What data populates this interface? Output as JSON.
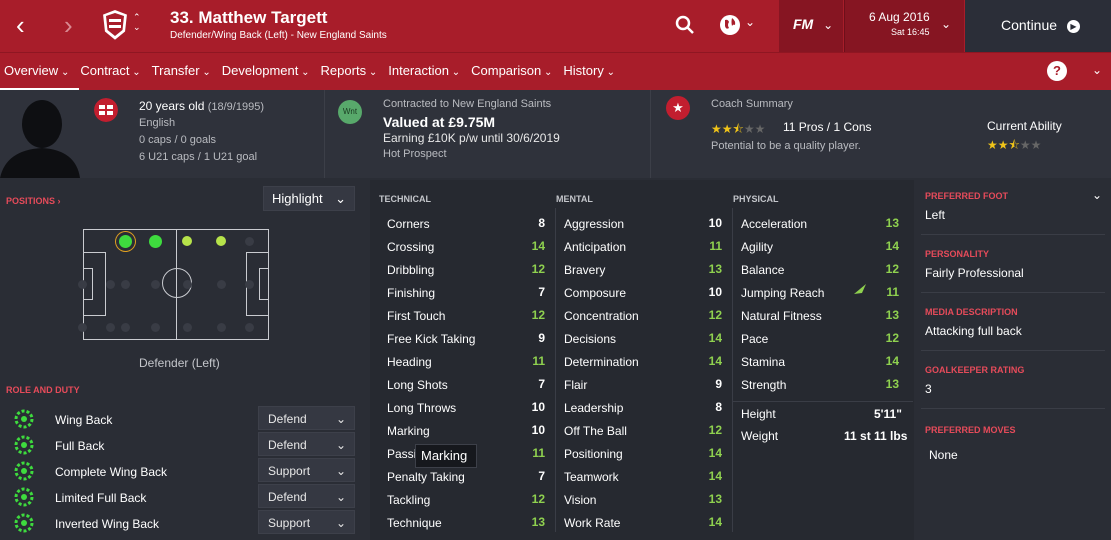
{
  "header": {
    "player_title": "33. Matthew Targett",
    "player_sub": "Defender/Wing Back (Left) - New England Saints",
    "fm_label": "FM",
    "date": "6 Aug 2016",
    "time": "Sat 16:45",
    "continue_label": "Continue"
  },
  "tabs": [
    "Overview",
    "Contract",
    "Transfer",
    "Development",
    "Reports",
    "Interaction",
    "Comparison",
    "History"
  ],
  "info": {
    "age": "20 years old",
    "dob": "(18/9/1995)",
    "nationality": "English",
    "caps": "0 caps / 0 goals",
    "u21": "6 U21 caps / 1 U21 goal",
    "contract_line": "Contracted to New England Saints",
    "value": "Valued at £9.75M",
    "earning": "Earning £10K p/w until 30/6/2019",
    "status": "Hot Prospect",
    "wnt_badge": "Wnt",
    "coach_title": "Coach Summary",
    "pros_cons": "11 Pros / 1 Cons",
    "potential_note": "Potential to be a quality player.",
    "current_ability_label": "Current Ability",
    "potential_stars": 2.5,
    "current_stars": 2.5
  },
  "positions": {
    "label": "POSITIONS",
    "highlight": "Highlight",
    "position_name": "Defender (Left)"
  },
  "role_title": "ROLE AND DUTY",
  "roles": [
    {
      "name": "Wing Back",
      "duty": "Defend"
    },
    {
      "name": "Full Back",
      "duty": "Defend"
    },
    {
      "name": "Complete Wing Back",
      "duty": "Support"
    },
    {
      "name": "Limited Full Back",
      "duty": "Defend"
    },
    {
      "name": "Inverted Wing Back",
      "duty": "Support"
    }
  ],
  "technical_head": "TECHNICAL",
  "mental_head": "MENTAL",
  "physical_head": "PHYSICAL",
  "technical": [
    {
      "name": "Corners",
      "value": "8"
    },
    {
      "name": "Crossing",
      "value": "14"
    },
    {
      "name": "Dribbling",
      "value": "12"
    },
    {
      "name": "Finishing",
      "value": "7"
    },
    {
      "name": "First Touch",
      "value": "12"
    },
    {
      "name": "Free Kick Taking",
      "value": "9"
    },
    {
      "name": "Heading",
      "value": "11"
    },
    {
      "name": "Long Shots",
      "value": "7"
    },
    {
      "name": "Long Throws",
      "value": "10"
    },
    {
      "name": "Marking",
      "value": "10"
    },
    {
      "name": "Passing",
      "value": "11"
    },
    {
      "name": "Penalty Taking",
      "value": "7"
    },
    {
      "name": "Tackling",
      "value": "12"
    },
    {
      "name": "Technique",
      "value": "13"
    }
  ],
  "mental": [
    {
      "name": "Aggression",
      "value": "10"
    },
    {
      "name": "Anticipation",
      "value": "11"
    },
    {
      "name": "Bravery",
      "value": "13"
    },
    {
      "name": "Composure",
      "value": "10"
    },
    {
      "name": "Concentration",
      "value": "12"
    },
    {
      "name": "Decisions",
      "value": "14"
    },
    {
      "name": "Determination",
      "value": "14"
    },
    {
      "name": "Flair",
      "value": "9"
    },
    {
      "name": "Leadership",
      "value": "8"
    },
    {
      "name": "Off The Ball",
      "value": "12"
    },
    {
      "name": "Positioning",
      "value": "14"
    },
    {
      "name": "Teamwork",
      "value": "14"
    },
    {
      "name": "Vision",
      "value": "13"
    },
    {
      "name": "Work Rate",
      "value": "14"
    }
  ],
  "physical": [
    {
      "name": "Acceleration",
      "value": "13"
    },
    {
      "name": "Agility",
      "value": "14"
    },
    {
      "name": "Balance",
      "value": "12"
    },
    {
      "name": "Jumping Reach",
      "value": "11"
    },
    {
      "name": "Natural Fitness",
      "value": "13"
    },
    {
      "name": "Pace",
      "value": "12"
    },
    {
      "name": "Stamina",
      "value": "14"
    },
    {
      "name": "Strength",
      "value": "13"
    }
  ],
  "physique": {
    "height_label": "Height",
    "height": "5'11\"",
    "weight_label": "Weight",
    "weight": "11 st 11 lbs"
  },
  "tooltip": "Marking",
  "right": {
    "foot_label": "PREFERRED FOOT",
    "foot": "Left",
    "personality_label": "PERSONALITY",
    "personality": "Fairly Professional",
    "media_label": "MEDIA DESCRIPTION",
    "media": "Attacking full back",
    "gk_label": "GOALKEEPER RATING",
    "gk": "3",
    "moves_label": "PREFERRED MOVES",
    "moves": "None"
  },
  "colors": {
    "red": "#a81d2a",
    "high": "#8fd14f",
    "mid": "#ffffff",
    "low": "#e8e8e8"
  }
}
